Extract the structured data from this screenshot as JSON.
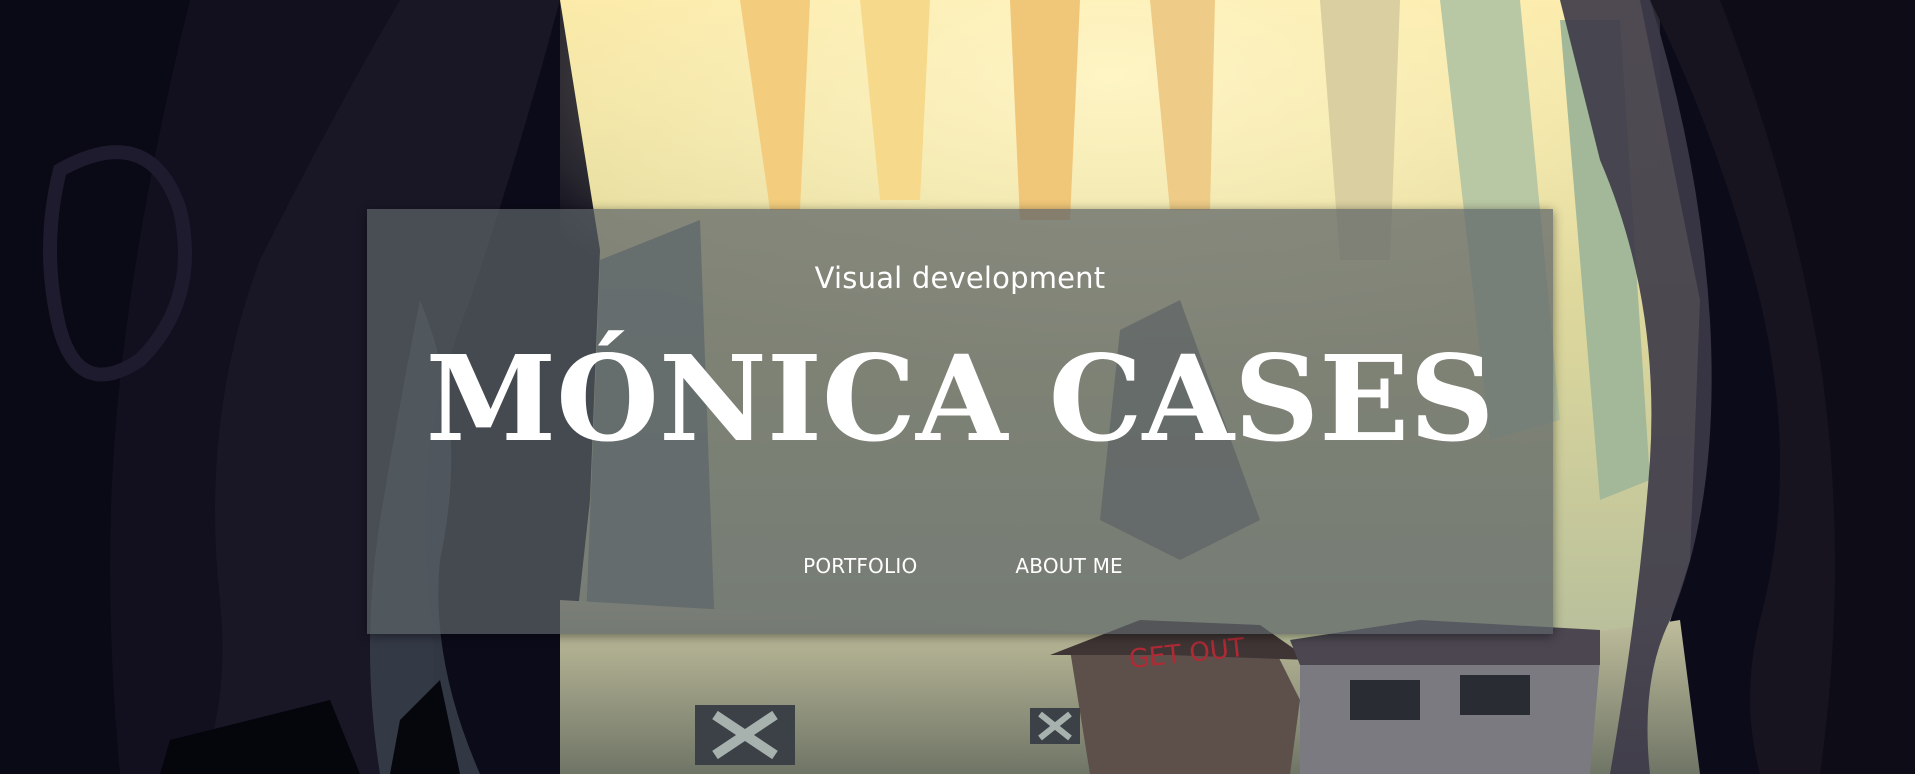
{
  "hero": {
    "subtitle": "Visual development",
    "name": "MÓNICA CASES"
  },
  "nav": {
    "items": [
      {
        "label": "PORTFOLIO"
      },
      {
        "label": "ABOUT ME"
      }
    ]
  },
  "background": {
    "sign_text": "GET OUT"
  },
  "colors": {
    "panel": "#5c6266",
    "text": "#ffffff",
    "forest_light": "#f7e3a0",
    "cave_dark": "#0d0c1c"
  }
}
